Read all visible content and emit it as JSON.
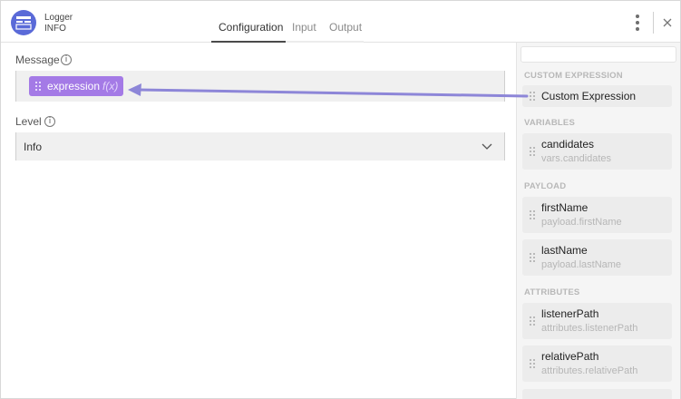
{
  "header": {
    "app_name": "Logger",
    "app_level": "INFO",
    "tabs": [
      {
        "label": "Configuration"
      },
      {
        "label": "Input"
      },
      {
        "label": "Output"
      }
    ]
  },
  "config": {
    "message_label": "Message",
    "message_pill": {
      "text": "expression",
      "fx": "f(x)"
    },
    "level_label": "Level",
    "level_value": "Info"
  },
  "sidebar": {
    "sections": [
      {
        "title": "CUSTOM EXPRESSION",
        "items": [
          {
            "name": "Custom Expression",
            "path": ""
          }
        ]
      },
      {
        "title": "VARIABLES",
        "items": [
          {
            "name": "candidates",
            "path": "vars.candidates"
          }
        ]
      },
      {
        "title": "PAYLOAD",
        "items": [
          {
            "name": "firstName",
            "path": "payload.firstName"
          },
          {
            "name": "lastName",
            "path": "payload.lastName"
          }
        ]
      },
      {
        "title": "ATTRIBUTES",
        "items": [
          {
            "name": "listenerPath",
            "path": "attributes.listenerPath"
          },
          {
            "name": "relativePath",
            "path": "attributes.relativePath"
          }
        ]
      }
    ]
  },
  "colors": {
    "accent_purple": "#a47ae6",
    "app_icon_blue": "#5a6ad8"
  },
  "icons": [
    "logger-app-icon",
    "info-icon",
    "chevron-down-icon",
    "more-vertical-icon",
    "close-icon",
    "drag-handle-icon"
  ]
}
